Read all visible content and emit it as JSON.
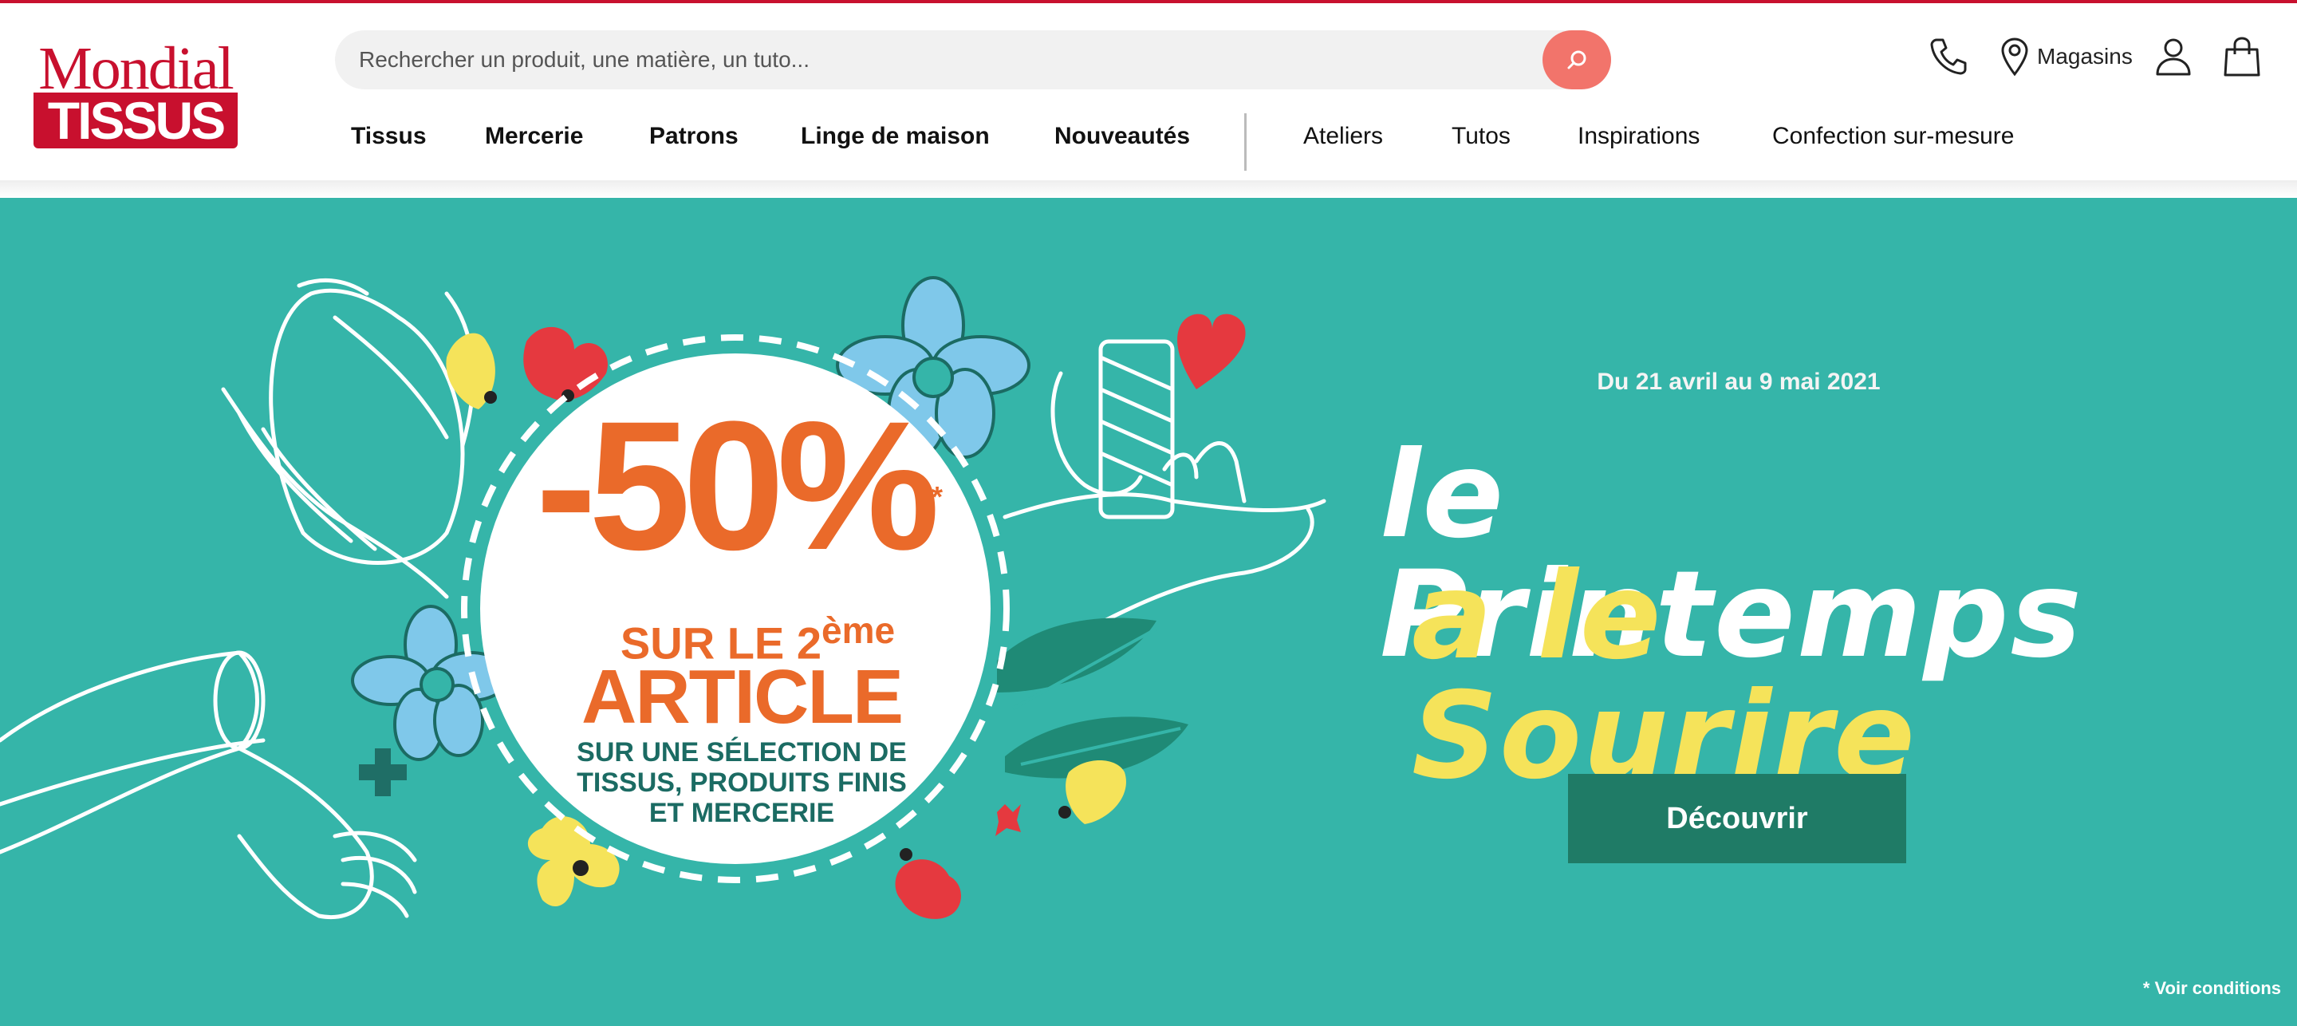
{
  "brand": {
    "line1": "Mondial",
    "line2": "TISSUS",
    "color": "#c8102e"
  },
  "search": {
    "placeholder": "Rechercher un produit, une matière, un tuto...",
    "icon": "search-icon"
  },
  "utilities": {
    "phone_icon": "phone-icon",
    "stores_label": "Magasins",
    "account_icon": "user-icon",
    "cart_icon": "shopping-bag-icon"
  },
  "nav": {
    "primary": [
      "Tissus",
      "Mercerie",
      "Patrons",
      "Linge de maison",
      "Nouveautés"
    ],
    "secondary": [
      "Ateliers",
      "Tutos",
      "Inspirations",
      "Confection sur-mesure"
    ]
  },
  "hero": {
    "background_color": "#35b5a9",
    "badge": {
      "discount": "-50%",
      "asterisk": "*",
      "line_sur": "SUR LE 2",
      "line_sur_sup": "ème",
      "line_article": "ARTICLE",
      "selection_1": "SUR UNE SÉLECTION DE",
      "selection_2": "TISSUS, PRODUITS FINIS",
      "selection_3": "ET MERCERIE"
    },
    "dates": "Du 21 avril au 9 mai 2021",
    "headline_line1": "le Printemps",
    "headline_line2": "a le Sourire",
    "cta_label": "Découvrir",
    "conditions": "* Voir conditions"
  }
}
